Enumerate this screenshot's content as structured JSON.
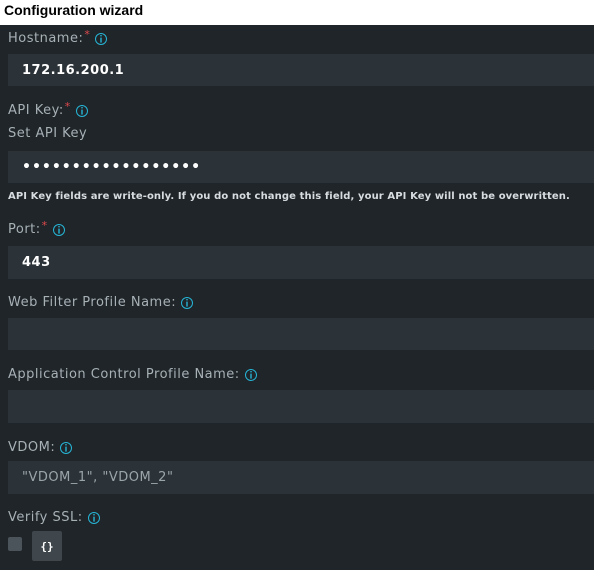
{
  "wizard": {
    "title": "Configuration wizard"
  },
  "form": {
    "hostname": {
      "label": "Hostname:",
      "required_mark": "*",
      "value": "172.16.200.1"
    },
    "api_key": {
      "label": "API Key:",
      "required_mark": "*",
      "sublabel": "Set API Key",
      "masked_value": "••••••••••••••••••",
      "help_text": "API Key fields are write-only. If you do not change this field, your API Key will not be overwritten."
    },
    "port": {
      "label": "Port:",
      "required_mark": "*",
      "value": "443"
    },
    "web_filter_profile": {
      "label": "Web Filter Profile Name:",
      "value": ""
    },
    "app_control_profile": {
      "label": "Application Control Profile Name:",
      "value": ""
    },
    "vdom": {
      "label": "VDOM:",
      "placeholder": "\"VDOM_1\", \"VDOM_2\""
    },
    "verify_ssl": {
      "label": "Verify SSL:",
      "checked": false,
      "button_label": "{}"
    }
  },
  "icons": {
    "info": "info-icon",
    "required": "asterisk"
  },
  "colors": {
    "panel_bg": "#1f2529",
    "input_bg": "#2b3338",
    "label": "#a7b1b6",
    "info_accent": "#27b5d6",
    "required": "#e0494d"
  }
}
